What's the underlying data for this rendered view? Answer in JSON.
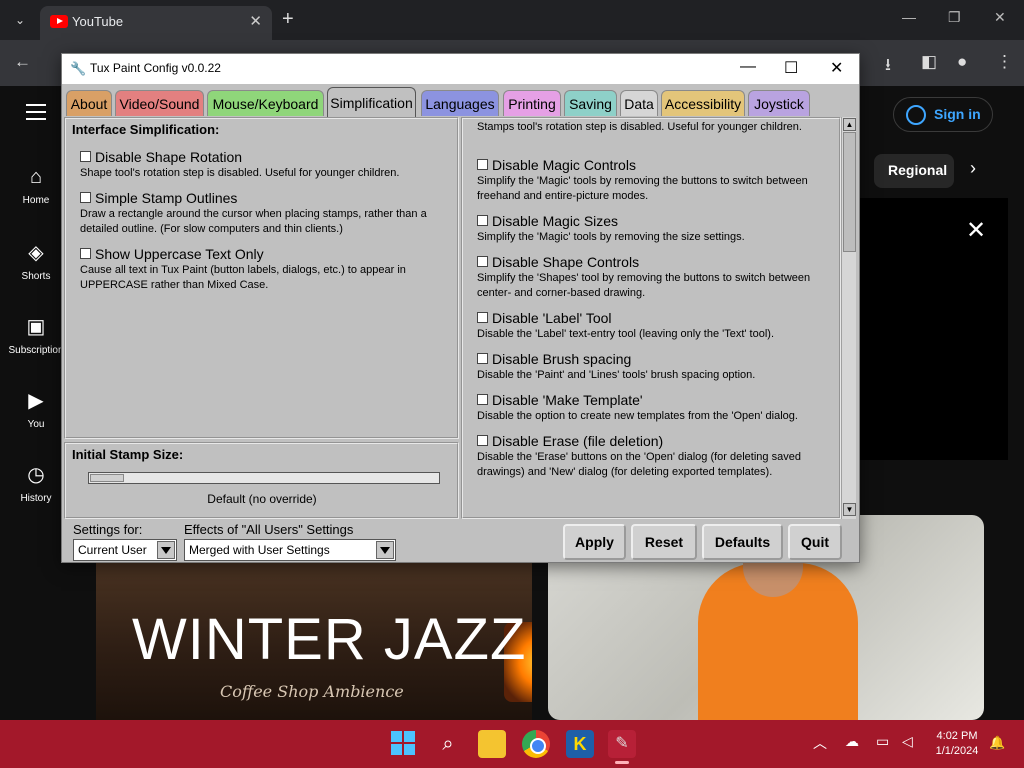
{
  "browser": {
    "tab_title": "YouTube",
    "tab_close": "✕",
    "new_tab": "+",
    "window_minimize": "—",
    "window_restore": "❐",
    "window_close": "✕"
  },
  "youtube": {
    "nav": [
      {
        "label": "Home",
        "icon": "home-icon",
        "glyph": "⌂"
      },
      {
        "label": "Shorts",
        "icon": "shorts-icon",
        "glyph": "◈"
      },
      {
        "label": "Subscription",
        "icon": "subscriptions-icon",
        "glyph": "▣"
      },
      {
        "label": "You",
        "icon": "you-icon",
        "glyph": "▶"
      },
      {
        "label": "History",
        "icon": "history-icon",
        "glyph": "◷"
      }
    ],
    "signin_label": "Sign in",
    "chip_label": "Regional",
    "chip_next": "›",
    "card_close": "✕",
    "thumb1_title": "WINTER JAZZ",
    "thumb1_subtitle": "Coffee Shop Ambience"
  },
  "app": {
    "title": "Tux Paint Config v0.0.22",
    "minimize": "—",
    "maximize": "☐",
    "close": "✕",
    "tabs": [
      {
        "label": "About",
        "color": "#d9a066"
      },
      {
        "label": "Video/Sound",
        "color": "#e38080"
      },
      {
        "label": "Mouse/Keyboard",
        "color": "#8fd67a"
      },
      {
        "label": "Simplification",
        "color": "#c0c0c0",
        "active": true
      },
      {
        "label": "Languages",
        "color": "#8c93e0"
      },
      {
        "label": "Printing",
        "color": "#e5a0e5"
      },
      {
        "label": "Saving",
        "color": "#8ed0c8"
      },
      {
        "label": "Data",
        "color": "#d6d6d6"
      },
      {
        "label": "Accessibility",
        "color": "#e3c57a"
      },
      {
        "label": "Joystick",
        "color": "#b9a3e0"
      }
    ],
    "interface_group_title": "Interface Simplification:",
    "left_options": [
      {
        "label": "Disable Shape Rotation",
        "desc": "Shape tool's rotation step is disabled. Useful for younger children."
      },
      {
        "label": "Simple Stamp Outlines",
        "desc": "Draw a rectangle around the cursor when placing stamps, rather than a detailed outline. (For slow computers and thin clients.)"
      },
      {
        "label": "Show Uppercase Text Only",
        "desc": "Cause all text in Tux Paint (button labels, dialogs, etc.) to appear in UPPERCASE rather than Mixed Case."
      }
    ],
    "stamp_group_title": "Initial Stamp Size:",
    "stamp_size_text": "Default (no override)",
    "right_top_text": "Stamps tool's rotation step is disabled. Useful for younger children.",
    "right_options": [
      {
        "label": "Disable Magic Controls",
        "desc": "Simplify the 'Magic' tools by removing the buttons to switch between freehand and entire-picture modes."
      },
      {
        "label": "Disable Magic Sizes",
        "desc": "Simplify the 'Magic' tools by removing the size settings."
      },
      {
        "label": "Disable Shape Controls",
        "desc": "Simplify the 'Shapes' tool by removing the buttons to switch between center- and corner-based drawing."
      },
      {
        "label": "Disable 'Label' Tool",
        "desc": "Disable the 'Label' text-entry tool (leaving only the 'Text' tool)."
      },
      {
        "label": "Disable Brush spacing",
        "desc": "Disable the 'Paint' and 'Lines' tools' brush spacing option."
      },
      {
        "label": "Disable 'Make Template'",
        "desc": "Disable the option to create new templates from the 'Open' dialog."
      },
      {
        "label": "Disable Erase (file deletion)",
        "desc": "Disable the 'Erase' buttons on the 'Open' dialog (for deleting saved drawings) and 'New' dialog (for deleting exported templates)."
      }
    ],
    "scroll_up": "▲",
    "scroll_down": "▼",
    "settings_for_label": "Settings for:",
    "settings_for_value": "Current User",
    "effects_label": "Effects of \"All Users\" Settings",
    "effects_value": "Merged with User Settings",
    "buttons": {
      "apply": "Apply",
      "reset": "Reset",
      "defaults": "Defaults",
      "quit": "Quit"
    }
  },
  "taskbar": {
    "time": "4:02 PM",
    "date": "1/1/2024",
    "search_glyph": "⌕",
    "app1_glyph": "K",
    "app2_glyph": "✎",
    "tray_chevron": "︿",
    "bell": "🔔"
  }
}
